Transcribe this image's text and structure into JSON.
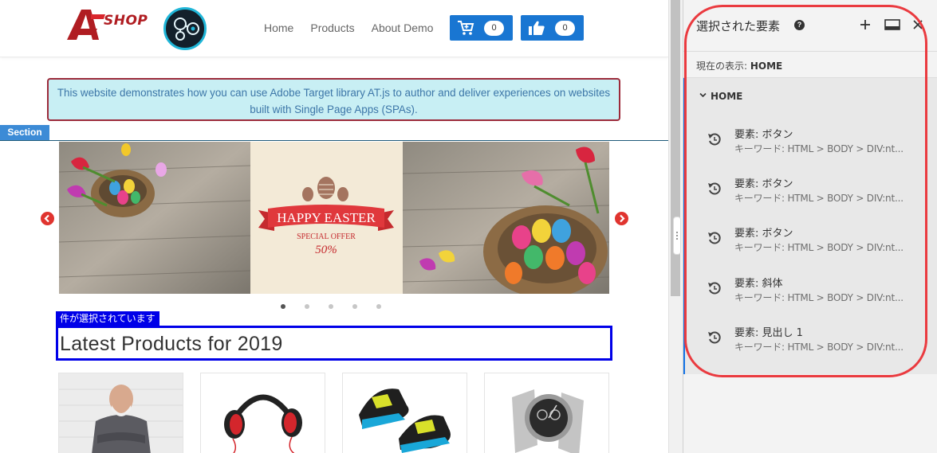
{
  "site": {
    "logo_text": "SHOP",
    "nav": [
      "Home",
      "Products",
      "About Demo"
    ],
    "cart_count": "0",
    "like_count": "0",
    "notice": "This website demonstrates how you can use Adobe Target library AT.js to author and deliver experiences on websites built with Single Page Apps (SPAs).",
    "section_tag": "Section",
    "banner": {
      "headline": "HAPPY EASTER",
      "subline": "SPECIAL OFFER",
      "discount": "50%"
    },
    "carousel": {
      "slides": 5,
      "active": 1
    },
    "selection_tag": "件が選択されています",
    "heading": "Latest Products for 2019"
  },
  "panel": {
    "title": "選択された要素",
    "current_view_label": "現在の表示:",
    "current_view_value": "HOME",
    "group_label": "HOME",
    "changes": [
      {
        "title": "要素: ボタン",
        "subtitle": "キーワード: HTML > BODY > DIV:nt..."
      },
      {
        "title": "要素: ボタン",
        "subtitle": "キーワード: HTML > BODY > DIV:nt..."
      },
      {
        "title": "要素: ボタン",
        "subtitle": "キーワード: HTML > BODY > DIV:nt..."
      },
      {
        "title": "要素: 斜体",
        "subtitle": "キーワード: HTML > BODY > DIV:nt..."
      },
      {
        "title": "要素: 見出し 1",
        "subtitle": "キーワード: HTML > BODY > DIV:nt..."
      }
    ]
  },
  "colors": {
    "accent_blue": "#1976d2",
    "selection_blue": "#0000e8",
    "highlight_red": "#ea3a3f",
    "logo_red": "#b01d22"
  }
}
